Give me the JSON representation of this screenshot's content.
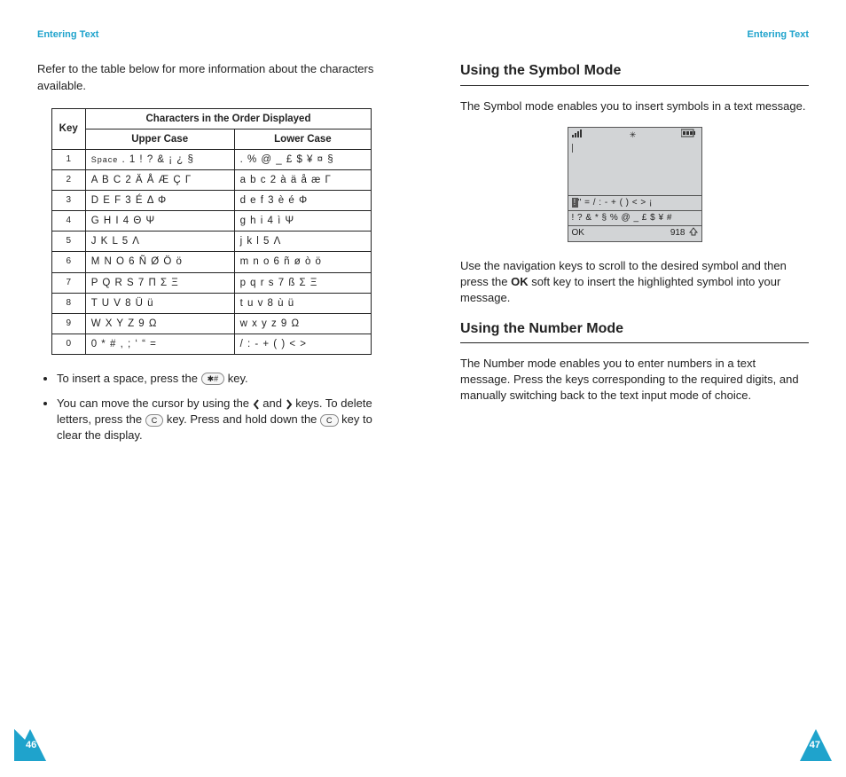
{
  "left": {
    "header": "Entering Text",
    "intro": "Refer to the table below for more information about the characters available.",
    "table": {
      "hKey": "Key",
      "hChars": "Characters in the Order Displayed",
      "hUpper": "Upper Case",
      "hLower": "Lower Case",
      "rows": [
        {
          "key": "1",
          "upperPrefix": "Space",
          "upper": " . 1 ! ? & ¡ ¿ §",
          "lower": ". % @ _ £ $ ¥ ¤ §"
        },
        {
          "key": "2",
          "upper": "A B C 2 Ä Å Æ Ç Γ",
          "lower": "a b c 2 à ä å æ Γ"
        },
        {
          "key": "3",
          "upper": "D E F 3 É Δ Φ",
          "lower": "d e f 3 è é Φ"
        },
        {
          "key": "4",
          "upper": "G H I 4 Θ Ψ",
          "lower": "g h i 4 ì Ψ"
        },
        {
          "key": "5",
          "upper": "J K L 5 Λ",
          "lower": "j k l 5 Λ"
        },
        {
          "key": "6",
          "upper": "M N O 6 Ñ Ø Ö ö",
          "lower": "m n o 6 ñ ø ò ö"
        },
        {
          "key": "7",
          "upper": "P Q R S 7 Π Σ Ξ",
          "lower": "p q r s 7 ß Σ Ξ"
        },
        {
          "key": "8",
          "upper": "T U V 8 Ü ü",
          "lower": "t u v 8 ù ü"
        },
        {
          "key": "9",
          "upper": "W X Y Z 9 Ω",
          "lower": "w x y z 9 Ω"
        },
        {
          "key": "0",
          "upper": "0 * # , ; ‘ “ =",
          "lower": "/ : - + ( ) < >"
        }
      ]
    },
    "bullet1_a": "To insert a space, press the ",
    "bullet1_b": " key.",
    "bullet2_a": "You can move the cursor by using the ",
    "bullet2_and": " and ",
    "bullet2_b": " keys. To delete letters, press the ",
    "bullet2_c": " key. Press and hold down the ",
    "bullet2_d": " key to clear the display.",
    "keycap_hash": "✱#",
    "keycap_c": "C",
    "pageNum": "46"
  },
  "right": {
    "header": "Entering Text",
    "h1": "Using the Symbol Mode",
    "p1": "The Symbol mode enables you to insert symbols in a text message.",
    "phone": {
      "symRow1_hl": "!",
      "symRow1_rest": "\" = / : - + ( ) < > ¡",
      "symRow2": "! ? & * § % @ _ £ $ ¥ #",
      "softLeft": "OK",
      "softRight": "918"
    },
    "p2_a": "Use the navigation keys to scroll to the desired symbol and then press the ",
    "p2_bold": "OK",
    "p2_b": " soft key to insert the highlighted symbol into your message.",
    "h2": "Using the Number Mode",
    "p3": "The Number mode enables you to enter numbers in a text message. Press the keys corresponding to the required digits, and manually switching back to the text input mode of choice.",
    "pageNum": "47"
  }
}
